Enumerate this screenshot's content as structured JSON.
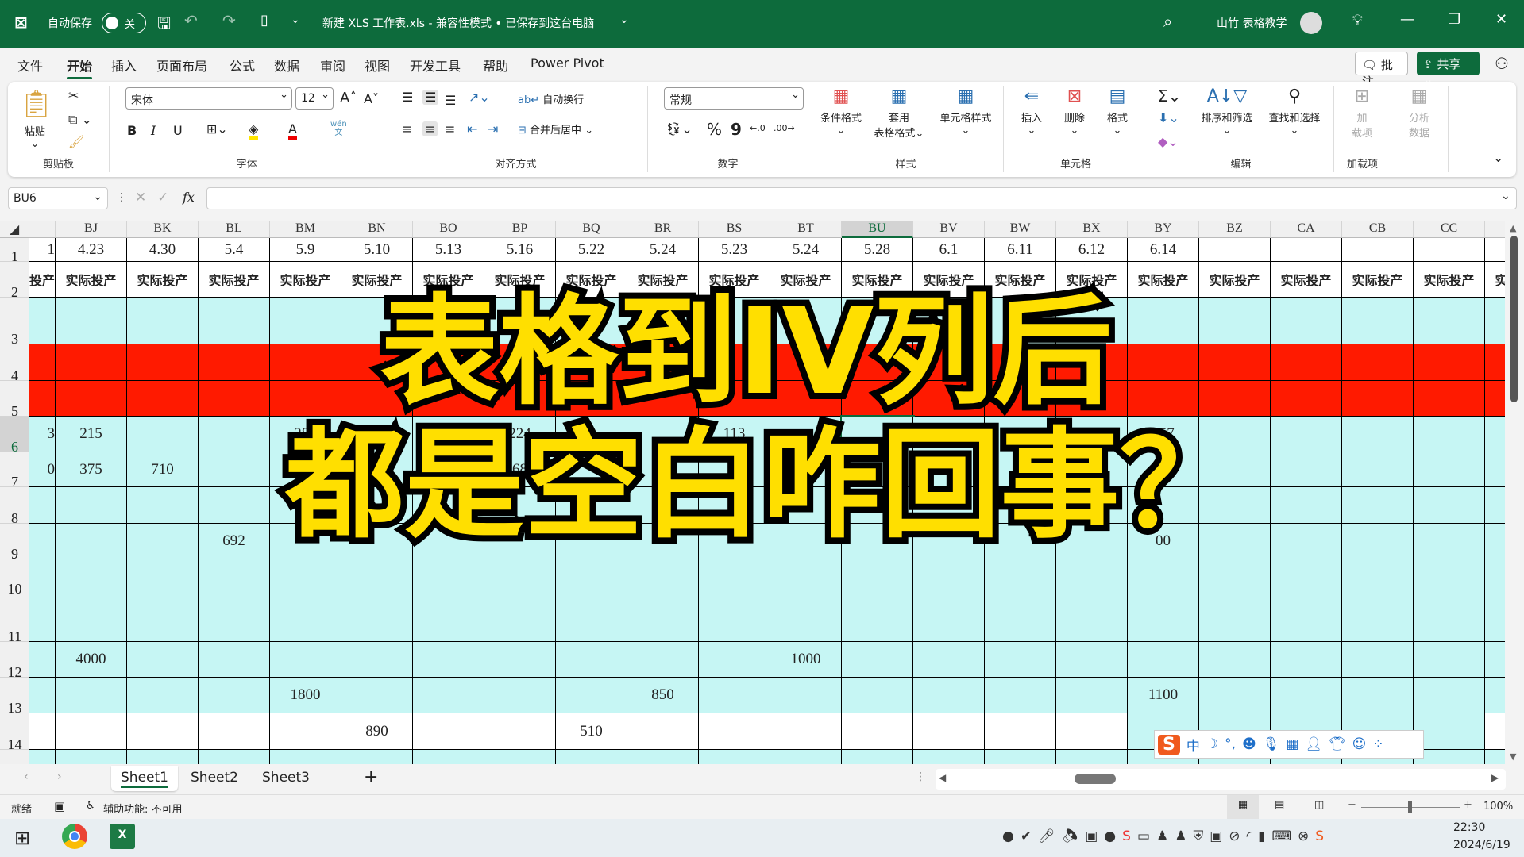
{
  "titlebar": {
    "autosave_label": "自动保存",
    "autosave_state": "关",
    "document_title": "新建 XLS 工作表.xls  -  兼容性模式 • 已保存到这台电脑",
    "user_name": "山竹 表格教学",
    "bg_color": "#0d6b3c"
  },
  "tabs": [
    {
      "label": "文件"
    },
    {
      "label": "开始",
      "active": true
    },
    {
      "label": "插入"
    },
    {
      "label": "页面布局"
    },
    {
      "label": "公式"
    },
    {
      "label": "数据"
    },
    {
      "label": "审阅"
    },
    {
      "label": "视图"
    },
    {
      "label": "开发工具"
    },
    {
      "label": "帮助"
    },
    {
      "label": "Power Pivot"
    }
  ],
  "header_buttons": {
    "comments": "批注",
    "share": "共享"
  },
  "ribbon": {
    "clipboard": {
      "label": "剪贴板",
      "paste": "粘贴"
    },
    "font": {
      "label": "字体",
      "font_name": "宋体",
      "font_size": "12",
      "bold": "B",
      "italic": "I",
      "underline": "U",
      "phonetic_top": "wén",
      "phonetic_bottom": "文"
    },
    "alignment": {
      "label": "对齐方式",
      "wrap": "自动换行",
      "merge": "合并后居中"
    },
    "number": {
      "label": "数字",
      "format": "常规",
      "percent": "%",
      "comma": "9"
    },
    "styles": {
      "label": "样式",
      "conditional": "条件格式",
      "table_1": "套用",
      "table_2": "表格格式",
      "cell_styles": "单元格样式"
    },
    "cells": {
      "label": "单元格",
      "insert": "插入",
      "delete": "删除",
      "format": "格式"
    },
    "editing": {
      "label": "编辑",
      "sort": "排序和筛选",
      "find": "查找和选择"
    },
    "addins": {
      "label": "加载项",
      "addins_1": "加",
      "addins_2": "载项"
    },
    "analysis": {
      "analyze_1": "分析",
      "analyze_2": "数据"
    }
  },
  "formula_bar": {
    "name_box": "BU6",
    "fx": "fx",
    "value": ""
  },
  "sheet": {
    "selected_column": "BU",
    "selected_row": 6,
    "first_partial_col": "BI",
    "columns": [
      "BJ",
      "BK",
      "BL",
      "BM",
      "BN",
      "BO",
      "BP",
      "BQ",
      "BR",
      "BS",
      "BT",
      "BU",
      "BV",
      "BW",
      "BX",
      "BY",
      "BZ",
      "CA",
      "CB",
      "CC"
    ],
    "rows": [
      1,
      2,
      3,
      4,
      5,
      6,
      7,
      8,
      9,
      10,
      11,
      12,
      13,
      14
    ],
    "row1": {
      "BI": "1",
      "BJ": "4.23",
      "BK": "4.30",
      "BL": "5.4",
      "BM": "5.9",
      "BN": "5.10",
      "BO": "5.13",
      "BP": "5.16",
      "BQ": "5.22",
      "BR": "5.24",
      "BS": "5.23",
      "BT": "5.24",
      "BU": "5.28",
      "BV": "6.1",
      "BW": "6.11",
      "BX": "6.12",
      "BY": "6.14"
    },
    "row2_label": "实际投产",
    "values": {
      "6": {
        "BI": "3",
        "BJ": "215",
        "BM": "287",
        "BP": "224",
        "BS": "113",
        "BY": "157"
      },
      "7": {
        "BI": "0",
        "BJ": "375",
        "BK": "710",
        "BM": "51",
        "BP": "68"
      },
      "9": {
        "BL": "692",
        "BY": "00"
      },
      "12": {
        "BJ": "4000",
        "BT": "1000"
      },
      "13": {
        "BM": "1800",
        "BR": "850",
        "BY": "1100"
      },
      "14": {
        "BN": "890",
        "BQ": "510"
      }
    },
    "colors": {
      "cyan": "#c6f6f4",
      "red": "#ff1a00",
      "white": "#ffffff"
    }
  },
  "overlay": {
    "line1": "表格到IV列后",
    "line2": "都是空白咋回事？",
    "color": "#ffdf00"
  },
  "sheet_tabs": [
    {
      "label": "Sheet1",
      "active": true
    },
    {
      "label": "Sheet2"
    },
    {
      "label": "Sheet3"
    }
  ],
  "status": {
    "ready": "就绪",
    "accessibility": "辅助功能: 不可用",
    "zoom": "100%",
    "zoom_level": 100
  },
  "ime": {
    "mode": "中"
  },
  "taskbar": {
    "time": "22:30",
    "date": "2024/6/19"
  }
}
